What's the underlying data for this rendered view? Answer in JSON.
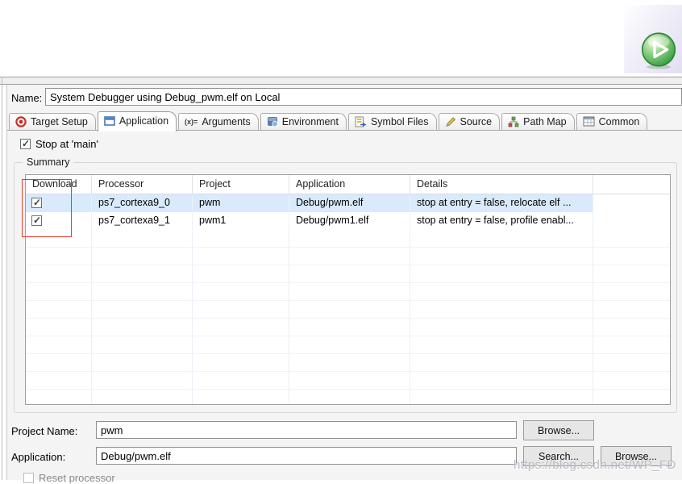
{
  "name_row": {
    "label": "Name:",
    "value": "System Debugger using Debug_pwm.elf on Local"
  },
  "tabs": [
    {
      "label": "Target Setup",
      "icon": "target-icon",
      "active": false
    },
    {
      "label": "Application",
      "icon": "application-window-icon",
      "active": true
    },
    {
      "label": "Arguments",
      "icon": "arguments-icon",
      "active": false
    },
    {
      "label": "Environment",
      "icon": "environment-icon",
      "active": false
    },
    {
      "label": "Symbol Files",
      "icon": "symbol-files-icon",
      "active": false
    },
    {
      "label": "Source",
      "icon": "source-icon",
      "active": false
    },
    {
      "label": "Path Map",
      "icon": "path-map-icon",
      "active": false
    },
    {
      "label": "Common",
      "icon": "common-icon",
      "active": false
    }
  ],
  "icons": {
    "arguments_glyph": "(x)=",
    "run_button": "run-icon"
  },
  "app_tab": {
    "stop_at_main": {
      "label": "Stop at 'main'",
      "checked": true
    },
    "summary_label": "Summary",
    "table": {
      "headers": {
        "download": "Download",
        "processor": "Processor",
        "project": "Project",
        "application": "Application",
        "details": "Details"
      },
      "rows": [
        {
          "download_checked": true,
          "processor": "ps7_cortexa9_0",
          "project": "pwm",
          "application": "Debug/pwm.elf",
          "details": "stop at entry = false, relocate elf ...",
          "selected": true
        },
        {
          "download_checked": true,
          "processor": "ps7_cortexa9_1",
          "project": "pwm1",
          "application": "Debug/pwm1.elf",
          "details": "stop at entry = false, profile enabl...",
          "selected": false
        }
      ]
    },
    "project_name": {
      "label": "Project Name:",
      "value": "pwm"
    },
    "application_field": {
      "label": "Application:",
      "value": "Debug/pwm.elf"
    },
    "buttons": {
      "browse_project": "Browse...",
      "search": "Search...",
      "browse_application": "Browse..."
    },
    "reset_processor": {
      "label": "Reset processor",
      "checked": false
    }
  },
  "annotation": {
    "shape": "red-rectangle-around-download-checkboxes",
    "color": "#e83a2c"
  },
  "watermark": "https://blog.csdn.net/WP_FD",
  "colors": {
    "selected_row": "#d8eafc",
    "pane_background": "#f4f4f4",
    "run_green": "#2f9a3f",
    "annotation_red": "#e83a2c"
  }
}
